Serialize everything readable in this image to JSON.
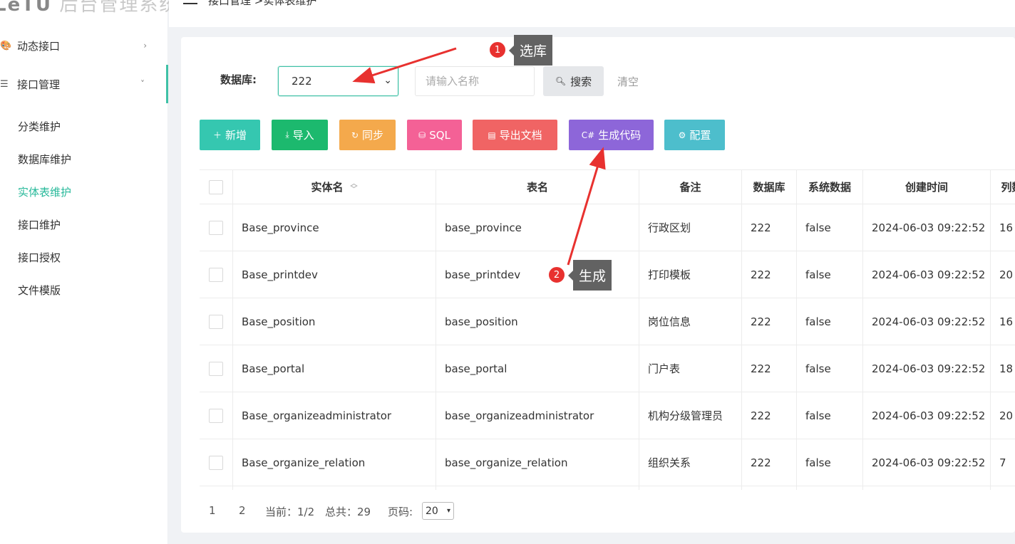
{
  "app": {
    "logo_mark": "LeTU",
    "logo_text": "后台管理系统"
  },
  "breadcrumb": "接口管理 >实体表维护",
  "sidebar": {
    "groups": [
      {
        "label": "动态接口",
        "arrow": "›"
      },
      {
        "label": "接口管理",
        "arrow": "˅"
      }
    ],
    "items": [
      {
        "label": "分类维护"
      },
      {
        "label": "数据库维护"
      },
      {
        "label": "实体表维护"
      },
      {
        "label": "接口维护"
      },
      {
        "label": "接口授权"
      },
      {
        "label": "文件模版"
      }
    ]
  },
  "filters": {
    "db_label": "数据库:",
    "db_value": "222",
    "name_placeholder": "请输入名称",
    "search_label": "搜索",
    "clear_label": "清空"
  },
  "toolbar": {
    "add": "新增",
    "import": "导入",
    "sync": "同步",
    "sql": "SQL",
    "export_doc": "导出文档",
    "gen_code": "生成代码",
    "config": "配置",
    "colors": {
      "add": "#35c7b0",
      "import": "#1cb96e",
      "sync": "#f4a94c",
      "sql": "#f46196",
      "export_doc": "#f06464",
      "gen_code": "#8d66d9",
      "config": "#4dbecc"
    }
  },
  "table": {
    "columns": [
      "实体名",
      "表名",
      "备注",
      "数据库",
      "系统数据",
      "创建时间",
      "列数"
    ],
    "rows": [
      {
        "entity": "Base_province",
        "table": "base_province",
        "remark": "行政区划",
        "db": "222",
        "sys": "false",
        "created": "2024-06-03 09:22:52",
        "cols": "16"
      },
      {
        "entity": "Base_printdev",
        "table": "base_printdev",
        "remark": "打印模板",
        "db": "222",
        "sys": "false",
        "created": "2024-06-03 09:22:52",
        "cols": "20"
      },
      {
        "entity": "Base_position",
        "table": "base_position",
        "remark": "岗位信息",
        "db": "222",
        "sys": "false",
        "created": "2024-06-03 09:22:52",
        "cols": "16"
      },
      {
        "entity": "Base_portal",
        "table": "base_portal",
        "remark": "门户表",
        "db": "222",
        "sys": "false",
        "created": "2024-06-03 09:22:52",
        "cols": "18"
      },
      {
        "entity": "Base_organizeadministrator",
        "table": "base_organizeadministrator",
        "remark": "机构分级管理员",
        "db": "222",
        "sys": "false",
        "created": "2024-06-03 09:22:52",
        "cols": "20"
      },
      {
        "entity": "Base_organize_relation",
        "table": "base_organize_relation",
        "remark": "组织关系",
        "db": "222",
        "sys": "false",
        "created": "2024-06-03 09:22:52",
        "cols": "7"
      }
    ]
  },
  "pager": {
    "page1": "1",
    "page2": "2",
    "current": "当前：1/2",
    "total": "总共：29",
    "size_label": "页码:",
    "size_value": "20"
  },
  "annotations": {
    "step1_num": "1",
    "step1_text": "选库",
    "step2_num": "2",
    "step2_text": "生成",
    "arrow_color": "#e8312f"
  }
}
